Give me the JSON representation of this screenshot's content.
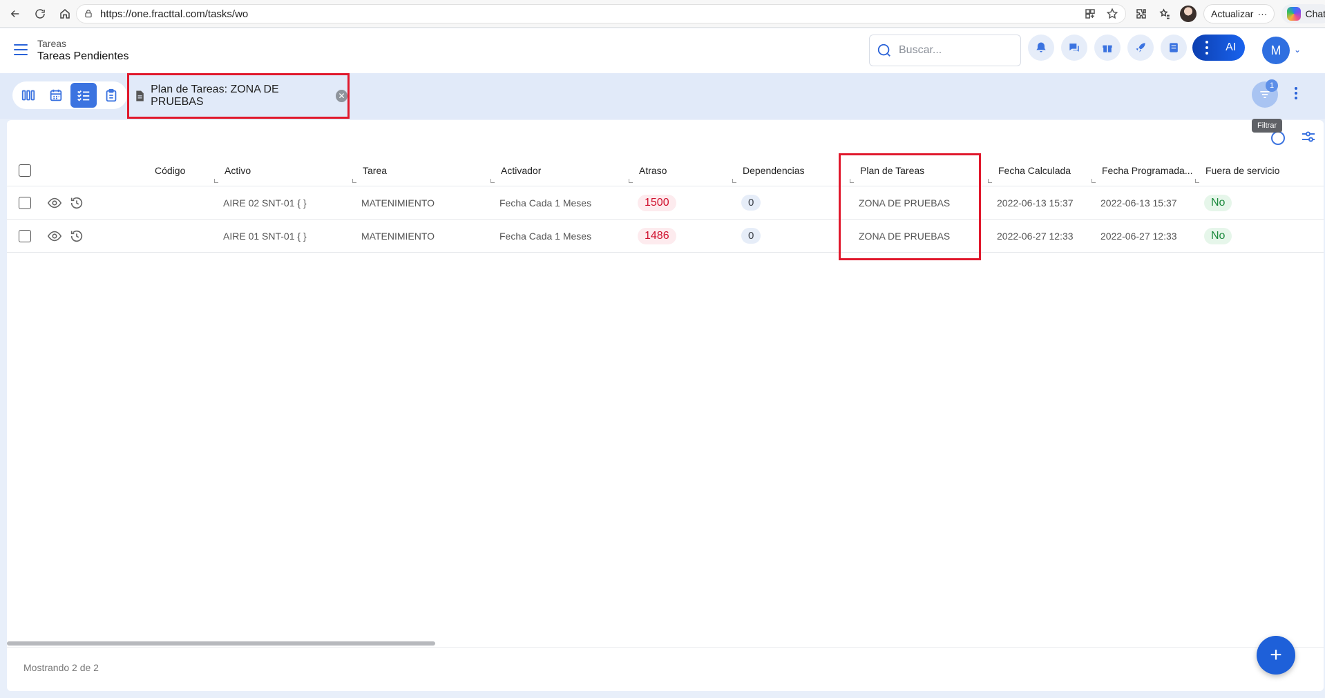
{
  "browser": {
    "url": "https://one.fracttal.com/tasks/wo",
    "update_label": "Actualizar",
    "chat_label": "Chat"
  },
  "header": {
    "breadcrumb": "Tareas",
    "title": "Tareas Pendientes",
    "search_placeholder": "Buscar...",
    "ai_label": "AI",
    "user_initial": "M"
  },
  "toolbar": {
    "filter_chip": "Plan de Tareas: ZONA DE PRUEBAS",
    "filter_badge": "1",
    "filter_tooltip": "Filtrar"
  },
  "table": {
    "columns": [
      "Código",
      "Activo",
      "Tarea",
      "Activador",
      "Atraso",
      "Dependencias",
      "Plan de Tareas",
      "Fecha Calculada",
      "Fecha Programada...",
      "Fuera de servicio"
    ],
    "rows": [
      {
        "codigo": "",
        "activo": "AIRE 02 SNT-01 { }",
        "tarea": "MATENIMIENTO",
        "activador": "Fecha Cada 1 Meses",
        "atraso": "1500",
        "dependencias": "0",
        "plan": "ZONA DE PRUEBAS",
        "fecha_calculada": "2022-06-13 15:37",
        "fecha_programada": "2022-06-13 15:37",
        "fuera_servicio": "No"
      },
      {
        "codigo": "",
        "activo": "AIRE 01 SNT-01 { }",
        "tarea": "MATENIMIENTO",
        "activador": "Fecha Cada 1 Meses",
        "atraso": "1486",
        "dependencias": "0",
        "plan": "ZONA DE PRUEBAS",
        "fecha_calculada": "2022-06-27 12:33",
        "fecha_programada": "2022-06-27 12:33",
        "fuera_servicio": "No"
      }
    ]
  },
  "footer": {
    "count_text": "Mostrando 2 de 2",
    "fab_label": "+"
  },
  "colors": {
    "accent": "#3b73e0",
    "highlight": "#e0182c",
    "delay": "#d0112e",
    "ok": "#1c8a3d"
  }
}
